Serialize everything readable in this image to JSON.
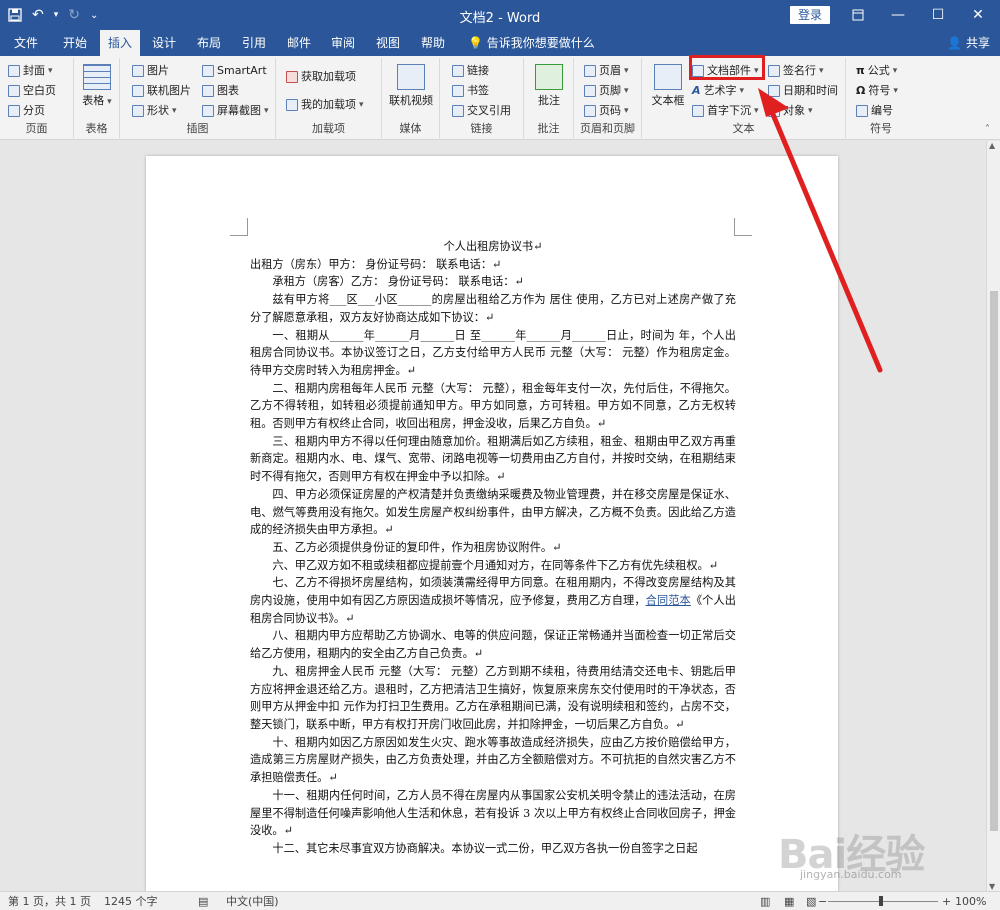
{
  "window": {
    "title": "文档2 - Word",
    "login_label": "登录"
  },
  "qat": {
    "save_icon": "save-icon",
    "undo_icon": "undo-icon",
    "redo_icon": "redo-icon",
    "customize_icon": "customize-icon"
  },
  "tabs": [
    "文件",
    "开始",
    "插入",
    "设计",
    "布局",
    "引用",
    "邮件",
    "审阅",
    "视图",
    "帮助"
  ],
  "active_tab": "插入",
  "tell_me": "告诉我你想要做什么",
  "share": "共享",
  "ribbon": {
    "pages": {
      "label": "页面",
      "items": [
        "封面",
        "空白页",
        "分页"
      ]
    },
    "tables": {
      "label": "表格",
      "button": "表格"
    },
    "illustrations": {
      "label": "插图",
      "items": [
        "图片",
        "联机图片",
        "形状",
        "SmartArt",
        "图表",
        "屏幕截图"
      ]
    },
    "addins": {
      "label": "加载项",
      "items": [
        "获取加载项",
        "我的加载项"
      ]
    },
    "media": {
      "label": "媒体",
      "button": "联机视频"
    },
    "links": {
      "label": "链接",
      "items": [
        "链接",
        "书签",
        "交叉引用"
      ]
    },
    "comments": {
      "label": "批注",
      "button": "批注"
    },
    "header_footer": {
      "label": "页眉和页脚",
      "items": [
        "页眉",
        "页脚",
        "页码"
      ]
    },
    "text": {
      "label": "文本",
      "textbox": "文本框",
      "items": [
        "文档部件",
        "艺术字",
        "首字下沉",
        "签名行",
        "日期和时间",
        "对象"
      ]
    },
    "symbols": {
      "label": "符号",
      "items": [
        "公式",
        "符号",
        "编号"
      ]
    }
  },
  "document": {
    "title": "个人出租房协议书↵",
    "paragraphs": [
      {
        "text": "出租方（房东）甲方：  身份证号码：  联系电话：↵",
        "indent": false
      },
      {
        "text": "承租方（房客）乙方：  身份证号码：  联系电话：↵",
        "indent": true
      },
      {
        "text": "兹有甲方将___区___小区______的房屋出租给乙方作为 居住 使用，乙方已对上述房产做了充分了解愿意承租，双方友好协商达成如下协议：↵",
        "indent": true
      },
      {
        "text": "一、租期从______年______月______日 至______年______月______日止，时间为 年，个人出租房合同协议书。本协议签订之日，乙方支付给甲方人民币 元整（大写： 元整）作为租房定金。待甲方交房时转入为租房押金。↵",
        "indent": true
      },
      {
        "text": "二、租期内房租每年人民币 元整（大写： 元整），租金每年支付一次，先付后住，不得拖欠。乙方不得转租，如转租必须提前通知甲方。甲方如同意，方可转租。甲方如不同意，乙方无权转租。否则甲方有权终止合同，收回出租房，押金没收，后果乙方自负。↵",
        "indent": true
      },
      {
        "text": "三、租期内甲方不得以任何理由随意加价。租期满后如乙方续租，租金、租期由甲乙双方再重新商定。租期内水、电、煤气、宽带、闭路电视等一切费用由乙方自付，并按时交纳，在租期结束时不得有拖欠，否则甲方有权在押金中予以扣除。↵",
        "indent": true
      },
      {
        "text": "四、甲方必须保证房屋的产权清楚并负责缴纳采暖费及物业管理费，并在移交房屋是保证水、电、燃气等费用没有拖欠。如发生房屋产权纠纷事件，由甲方解决，乙方概不负责。因此给乙方造成的经济损失由甲方承担。↵",
        "indent": true
      },
      {
        "text": "五、乙方必须提供身份证的复印件，作为租房协议附件。↵",
        "indent": true
      },
      {
        "text": "六、甲乙双方如不租或续租都应提前壹个月通知对方，在同等条件下乙方有优先续租权。↵",
        "indent": true
      },
      {
        "text": "七、乙方不得损坏房屋结构，如须装潢需经得甲方同意。在租用期内，不得改变房屋结构及其房内设施，使用中如有因乙方原因造成损坏等情况，应予修复，费用乙方自理，",
        "indent": true,
        "link": "合同范本",
        "after": "《个人出租房合同协议书》。↵"
      },
      {
        "text": "八、租期内甲方应帮助乙方协调水、电等的供应问题，保证正常畅通并当面检查一切正常后交给乙方使用，租期内的安全由乙方自己负责。↵",
        "indent": true
      },
      {
        "text": "九、租房押金人民币 元整（大写： 元整）乙方到期不续租，待费用结清交还电卡、钥匙后甲方应将押金退还给乙方。退租时，乙方把清洁卫生搞好，恢复原来房东交付使用时的干净状态，否则甲方从押金中扣 元作为打扫卫生费用。乙方在承租期间已满，没有说明续租和签约，占房不交，整天锁门，联系中断，甲方有权打开房门收回此房，并扣除押金，一切后果乙方自负。↵",
        "indent": true
      },
      {
        "text": "十、租期内如因乙方原因如发生火灾、跑水等事故造成经济损失，应由乙方按价赔偿给甲方，造成第三方房屋财产损失，由乙方负责处理，并由乙方全额赔偿对方。不可抗拒的自然灾害乙方不承担赔偿责任。↵",
        "indent": true
      },
      {
        "text": "十一、租期内任何时间，乙方人员不得在房屋内从事国家公安机关明令禁止的违法活动，在房屋里不得制造任何噪声影响他人生活和休息，若有投诉 3 次以上甲方有权终止合同收回房子，押金没收。↵",
        "indent": true
      },
      {
        "text": "十二、其它未尽事宜双方协商解决。本协议一式二份，甲乙双方各执一份自签字之日起",
        "indent": true
      }
    ]
  },
  "status": {
    "page": "第 1 页，共 1 页",
    "words": "1245 个字",
    "language": "中文(中国)",
    "zoom": "100%"
  },
  "watermark": {
    "brand": "Bai经验",
    "url": "jingyan.baidu.com"
  },
  "colors": {
    "accent": "#2b579a",
    "highlight": "#e02020"
  }
}
